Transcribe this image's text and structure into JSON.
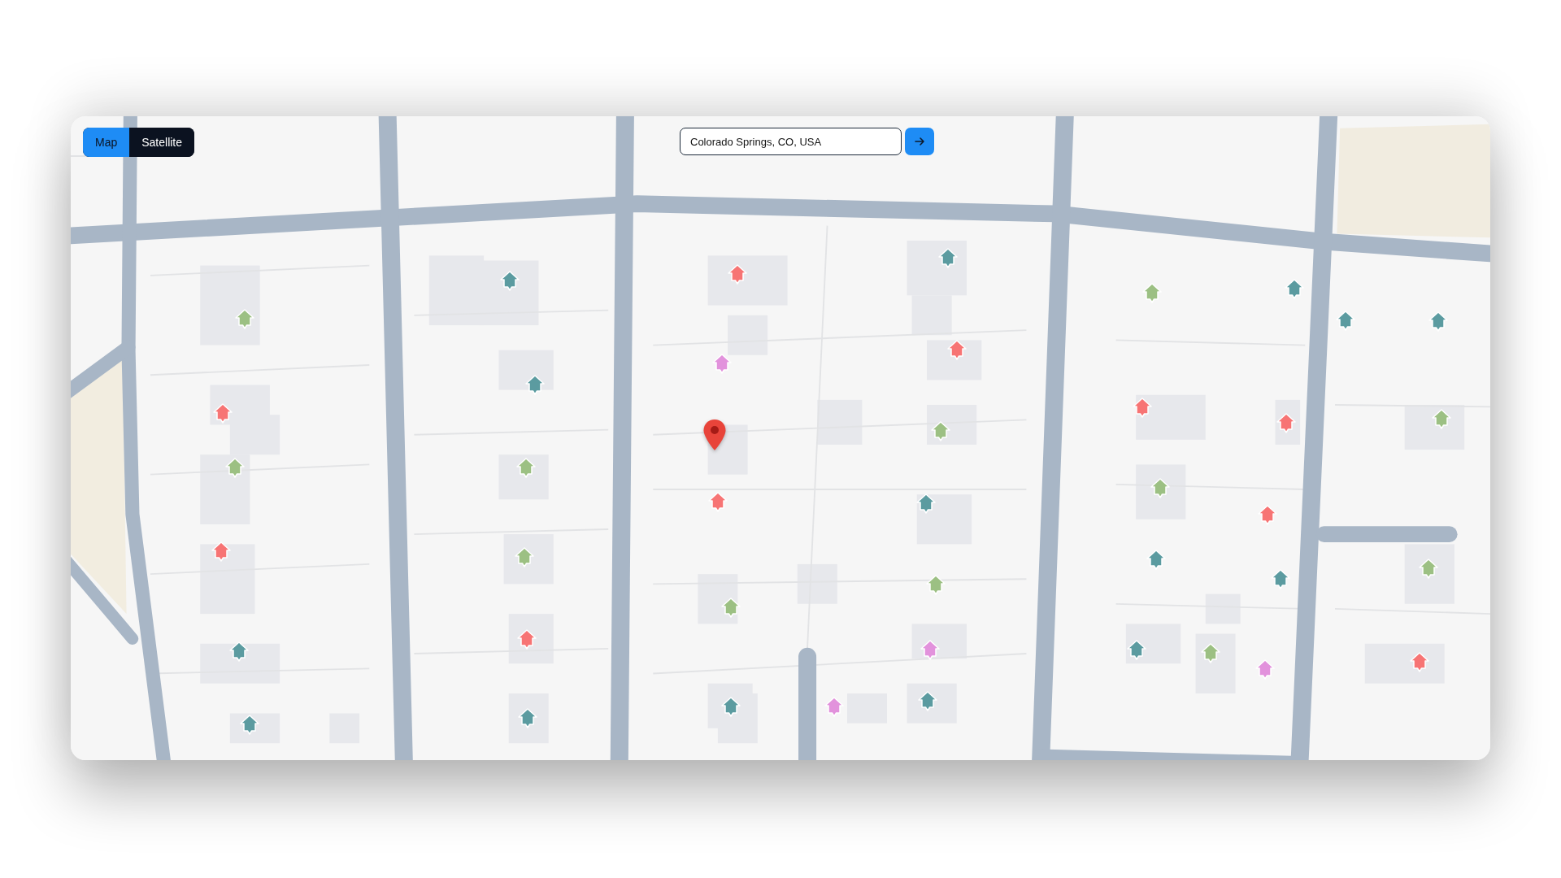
{
  "map_type_toggle": [
    {
      "label": "Map",
      "selected": true
    },
    {
      "label": "Satellite",
      "selected": false
    }
  ],
  "search": {
    "value": "Colorado Springs, CO, USA"
  },
  "markers": [
    {
      "color": "#5b9ba0"
    },
    {
      "color": "#f77474"
    },
    {
      "color": "#5b9ba0"
    },
    {
      "color": "#9cc083"
    },
    {
      "color": "#9cc083"
    },
    {
      "color": "#5b9ba0"
    },
    {
      "color": "#5b9ba0"
    },
    {
      "color": "#5b9ba0"
    },
    {
      "color": "#e292dc"
    },
    {
      "color": "#f77474"
    },
    {
      "color": "#5b9ba0"
    },
    {
      "color": "#f77474"
    },
    {
      "color": "#f77474"
    },
    {
      "color": "#f77474"
    },
    {
      "color": "#9cc083"
    },
    {
      "color": "#9cc083"
    },
    {
      "color": "#9cc083"
    },
    {
      "color": "#9cc083"
    },
    {
      "color": "#f77474"
    },
    {
      "color": "#5b9ba0"
    },
    {
      "color": "#9cc083"
    },
    {
      "color": "#f77474"
    },
    {
      "color": "#f77474"
    },
    {
      "color": "#9cc083"
    },
    {
      "color": "#5b9ba0"
    },
    {
      "color": "#5b9ba0"
    },
    {
      "color": "#9cc083"
    },
    {
      "color": "#9cc083"
    },
    {
      "color": "#9cc083"
    },
    {
      "color": "#5b9ba0"
    },
    {
      "color": "#f77474"
    },
    {
      "color": "#e292dc"
    },
    {
      "color": "#5b9ba0"
    },
    {
      "color": "#9cc083"
    },
    {
      "color": "#e292dc"
    },
    {
      "color": "#f77474"
    },
    {
      "color": "#5b9ba0"
    },
    {
      "color": "#5b9ba0"
    },
    {
      "color": "#5b9ba0"
    },
    {
      "color": "#e292dc"
    },
    {
      "color": "#5b9ba0"
    }
  ]
}
